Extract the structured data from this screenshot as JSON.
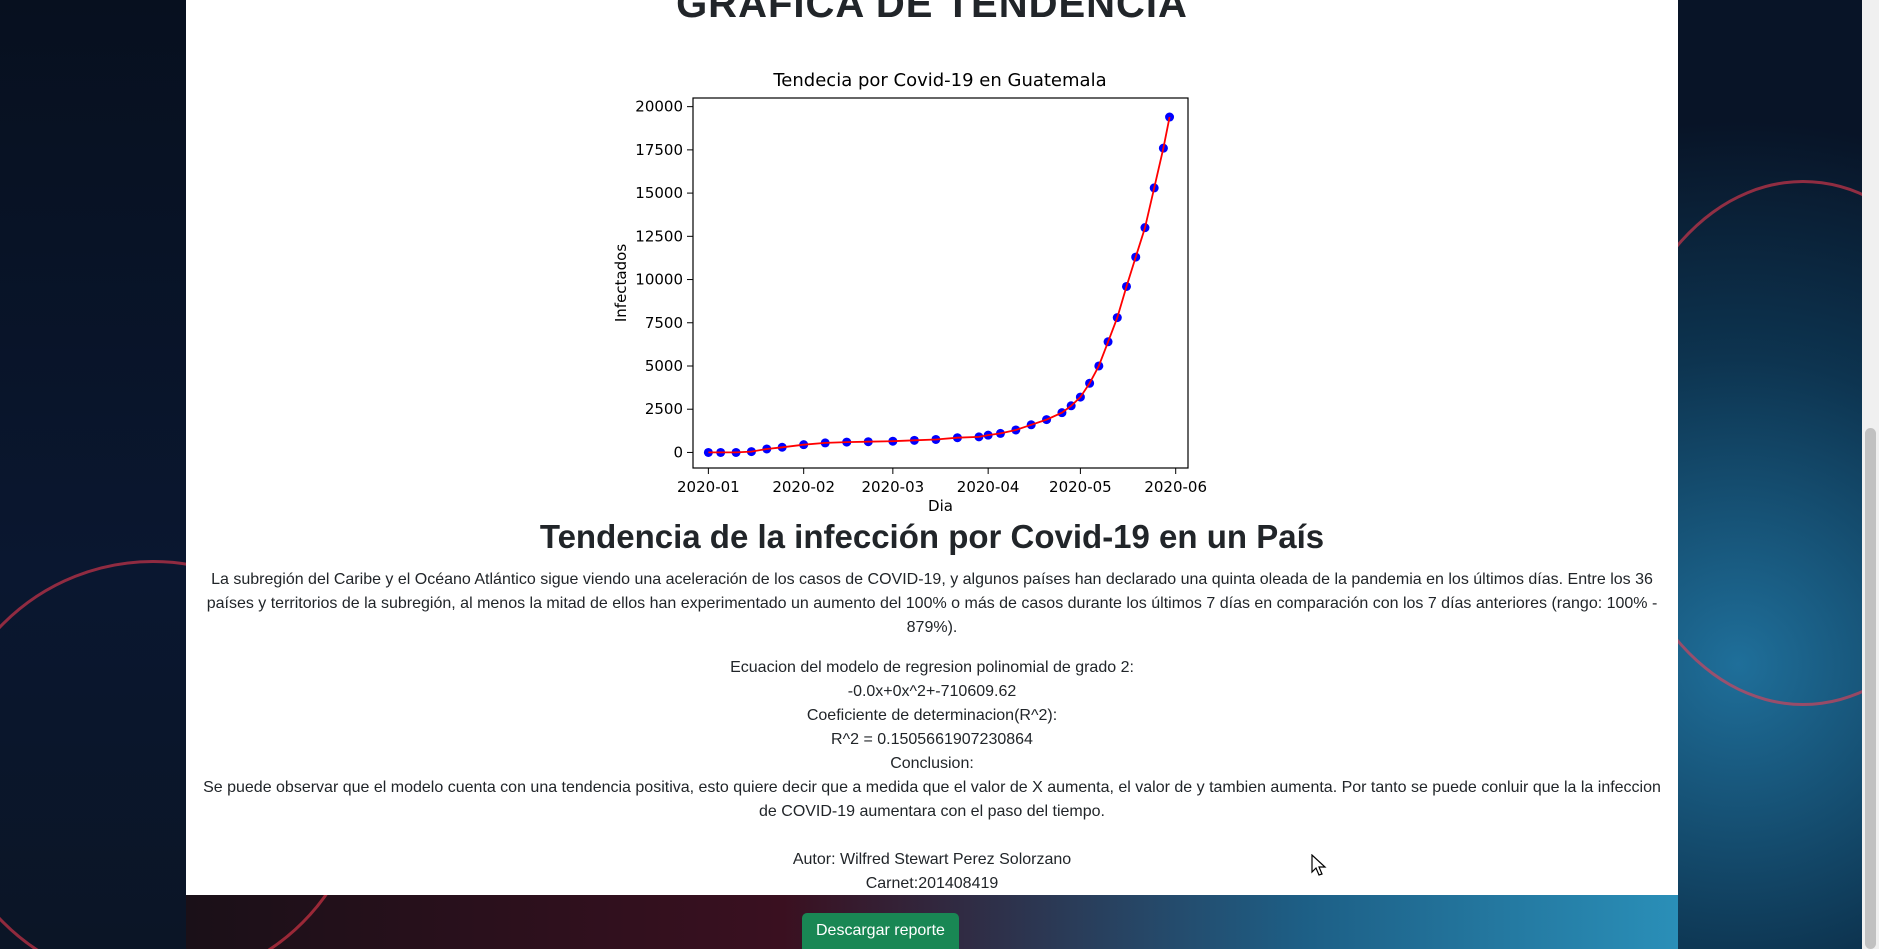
{
  "page": {
    "title": "GRÁFICA DE TENDENCIA",
    "section_title": "Tendencia de la infección por Covid-19 en un País",
    "description": "La subregión del Caribe y el Océano Atlántico sigue viendo una aceleración de los casos de COVID-19, y algunos países han declarado una quinta oleada de la pandemia en los últimos días. Entre los 36 países y territorios de la subregión, al menos la mitad de ellos han experimentado un aumento del 100% o más de casos durante los últimos 7 días en comparación con los 7 días anteriores (rango: 100% - 879%).",
    "equation_label": "Ecuacion del modelo de regresion polinomial de grado 2:",
    "equation": "-0.0x+0x^2+-710609.62",
    "r2_label": "Coeficiente de determinacion(R^2):",
    "r2_value": "R^2 = 0.1505661907230864",
    "conclusion_label": "Conclusion:",
    "conclusion_text": "Se puede observar que el modelo cuenta con una tendencia positiva, esto quiere decir que a medida que el valor de X aumenta, el valor de y tambien aumenta. Por tanto se puede conluir que la la infeccion de COVID-19 aumentara con el paso del tiempo.",
    "author": "Autor: Wilfred Stewart Perez Solorzano",
    "carnet": "Carnet:201408419",
    "download_button": "Descargar reporte"
  },
  "colors": {
    "button": "#198754",
    "points": "#0000ff",
    "trend_line": "#ff0000"
  },
  "chart_data": {
    "type": "scatter",
    "title": "Tendecia por Covid-19 en Guatemala",
    "xlabel": "Dia",
    "ylabel": "Infectados",
    "x_tick_labels": [
      "2020-01",
      "2020-02",
      "2020-03",
      "2020-04",
      "2020-05",
      "2020-06"
    ],
    "y_tick_labels": [
      "0",
      "2500",
      "5000",
      "7500",
      "10000",
      "12500",
      "15000",
      "17500",
      "20000"
    ],
    "ylim": [
      -900,
      20500
    ],
    "xlim": [
      "2019-12-27",
      "2020-06-05"
    ],
    "grid": false,
    "series": [
      {
        "marker": "circle",
        "x": [
          "2020-01-01",
          "2020-01-05",
          "2020-01-10",
          "2020-01-15",
          "2020-01-20",
          "2020-01-25",
          "2020-02-01",
          "2020-02-08",
          "2020-02-15",
          "2020-02-22",
          "2020-03-01",
          "2020-03-08",
          "2020-03-15",
          "2020-03-22",
          "2020-03-29",
          "2020-04-01",
          "2020-04-05",
          "2020-04-10",
          "2020-04-15",
          "2020-04-20",
          "2020-04-25",
          "2020-04-28",
          "2020-05-01",
          "2020-05-04",
          "2020-05-07",
          "2020-05-10",
          "2020-05-13",
          "2020-05-16",
          "2020-05-19",
          "2020-05-22",
          "2020-05-25",
          "2020-05-28",
          "2020-05-30"
        ],
        "y": [
          0,
          0,
          0,
          50,
          200,
          300,
          450,
          550,
          600,
          620,
          650,
          700,
          750,
          850,
          900,
          1000,
          1100,
          1300,
          1600,
          1900,
          2300,
          2700,
          3200,
          4000,
          5000,
          6400,
          7800,
          9600,
          11300,
          13000,
          15300,
          17600,
          19400
        ]
      },
      {
        "name": "trend",
        "style": "line",
        "x": [
          "2020-01-01",
          "2020-01-05",
          "2020-01-10",
          "2020-01-15",
          "2020-01-20",
          "2020-01-25",
          "2020-02-01",
          "2020-02-08",
          "2020-02-15",
          "2020-02-22",
          "2020-03-01",
          "2020-03-08",
          "2020-03-15",
          "2020-03-22",
          "2020-03-29",
          "2020-04-01",
          "2020-04-05",
          "2020-04-10",
          "2020-04-15",
          "2020-04-20",
          "2020-04-25",
          "2020-04-28",
          "2020-05-01",
          "2020-05-04",
          "2020-05-07",
          "2020-05-10",
          "2020-05-13",
          "2020-05-16",
          "2020-05-19",
          "2020-05-22",
          "2020-05-25",
          "2020-05-28",
          "2020-05-30"
        ],
        "y": [
          0,
          0,
          0,
          50,
          200,
          300,
          450,
          550,
          600,
          620,
          650,
          700,
          750,
          850,
          900,
          1000,
          1100,
          1300,
          1600,
          1900,
          2300,
          2700,
          3200,
          4000,
          5000,
          6400,
          7800,
          9600,
          11300,
          13000,
          15300,
          17600,
          19400
        ]
      }
    ]
  }
}
